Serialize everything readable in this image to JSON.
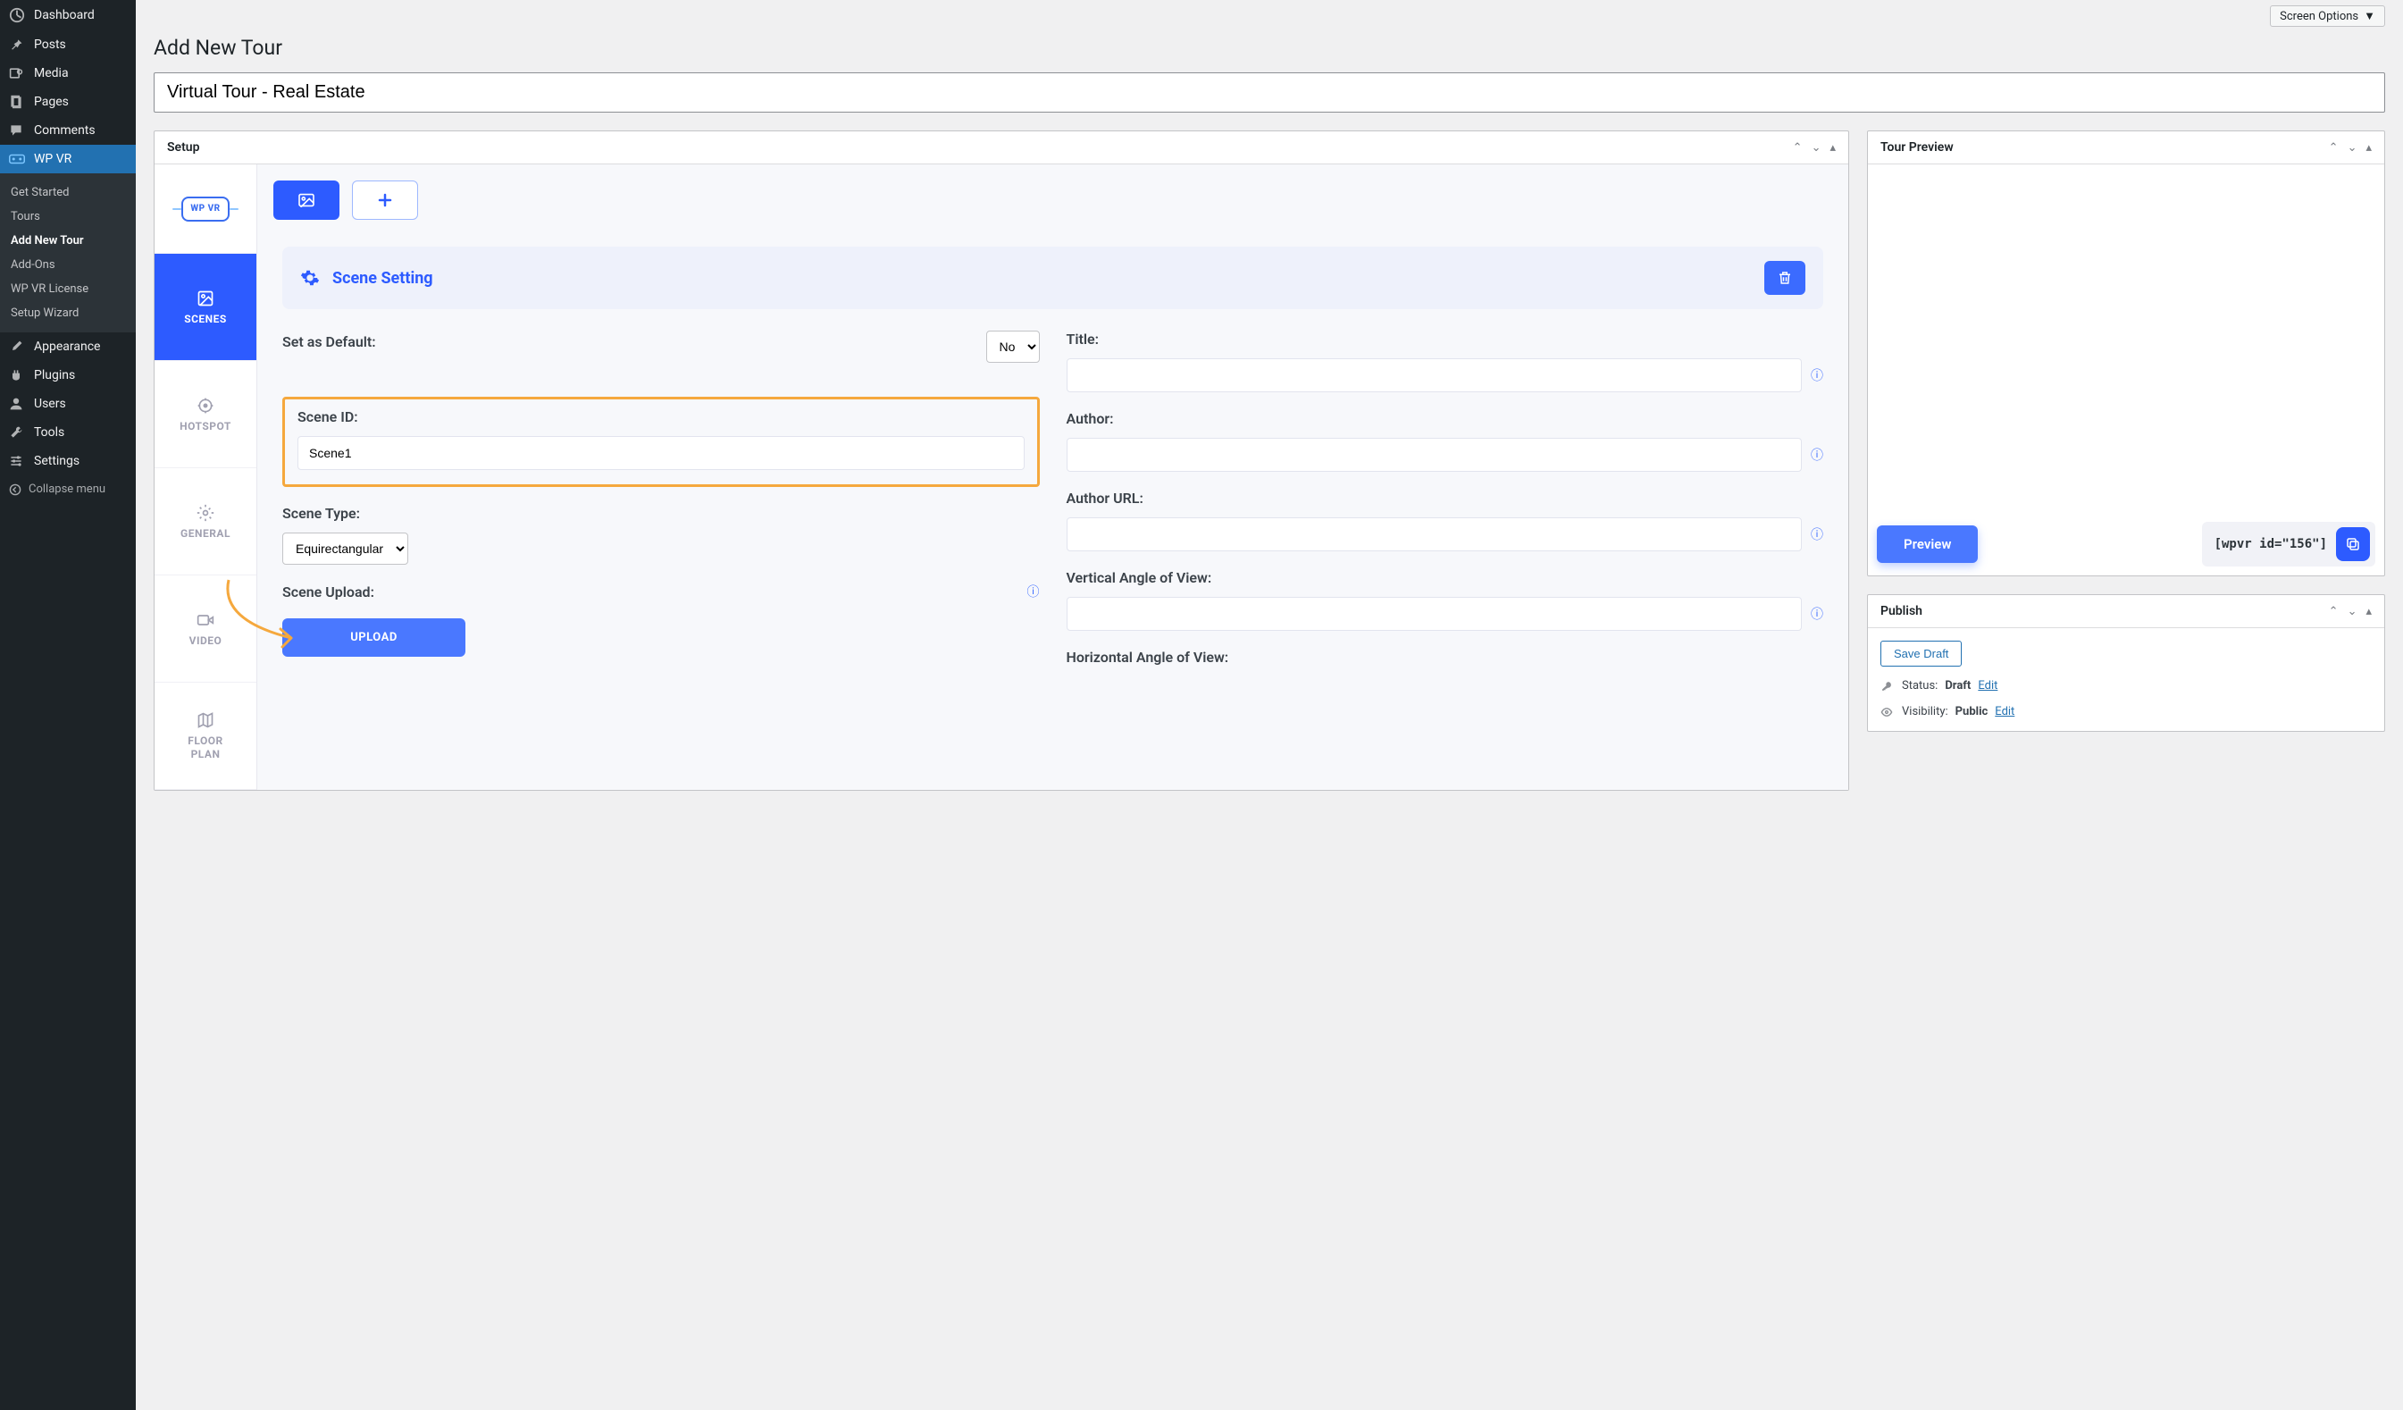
{
  "sidebar": {
    "items": [
      {
        "label": "Dashboard"
      },
      {
        "label": "Posts"
      },
      {
        "label": "Media"
      },
      {
        "label": "Pages"
      },
      {
        "label": "Comments"
      },
      {
        "label": "WP VR"
      },
      {
        "label": "Appearance"
      },
      {
        "label": "Plugins"
      },
      {
        "label": "Users"
      },
      {
        "label": "Tools"
      },
      {
        "label": "Settings"
      }
    ],
    "wpvr_sub": [
      "Get Started",
      "Tours",
      "Add New Tour",
      "Add-Ons",
      "WP VR License",
      "Setup Wizard"
    ],
    "collapse": "Collapse menu"
  },
  "topbar": {
    "screen_options": "Screen Options"
  },
  "page": {
    "title": "Add New Tour",
    "tour_title_value": "Virtual Tour - Real Estate"
  },
  "setup": {
    "heading": "Setup",
    "vtabs": {
      "logo": "WP VR",
      "scenes": "SCENES",
      "hotspot": "HOTSPOT",
      "general": "GENERAL",
      "video": "VIDEO",
      "floorplan": "FLOOR\nPLAN"
    },
    "scene_setting": "Scene Setting",
    "fields": {
      "default_label": "Set as Default:",
      "default_value": "No",
      "scene_id_label": "Scene ID:",
      "scene_id_value": "Scene1",
      "scene_type_label": "Scene Type:",
      "scene_type_value": "Equirectangular",
      "scene_upload_label": "Scene Upload:",
      "upload_btn": "UPLOAD",
      "title_label": "Title:",
      "author_label": "Author:",
      "author_url_label": "Author URL:",
      "vaov_label": "Vertical Angle of View:",
      "haov_label": "Horizontal Angle of View:"
    }
  },
  "preview": {
    "heading": "Tour Preview",
    "button": "Preview",
    "shortcode": "[wpvr id=\"156\"]"
  },
  "publish": {
    "heading": "Publish",
    "save_draft": "Save Draft",
    "status_label": "Status:",
    "status_value": "Draft",
    "visibility_label": "Visibility:",
    "visibility_value": "Public",
    "edit": "Edit"
  }
}
